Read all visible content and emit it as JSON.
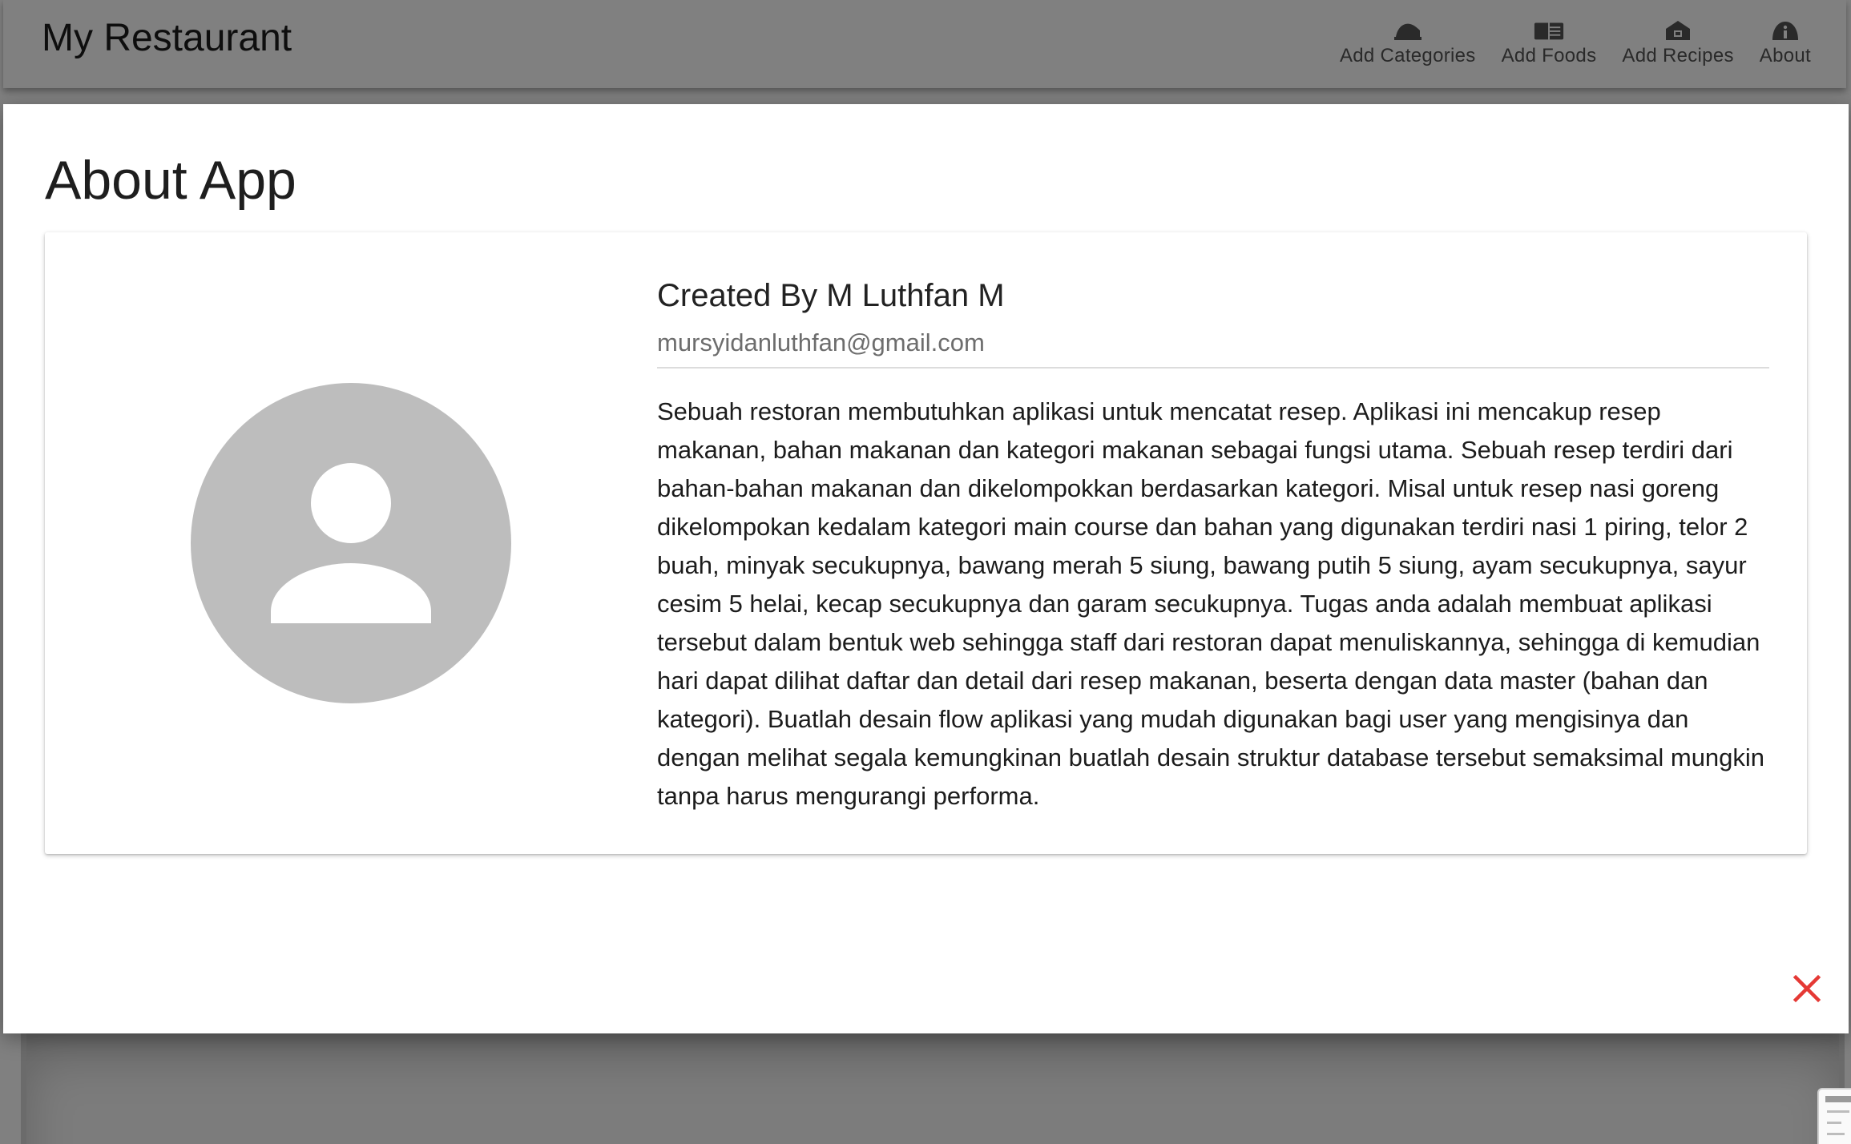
{
  "app": {
    "brand": "My Restaurant"
  },
  "nav": {
    "items": [
      {
        "label": "Add Categories",
        "icon": "categories-icon"
      },
      {
        "label": "Add Foods",
        "icon": "book-icon"
      },
      {
        "label": "Add Recipes",
        "icon": "store-icon"
      },
      {
        "label": "About",
        "icon": "info-icon"
      }
    ]
  },
  "modal": {
    "title": "About App",
    "creator": "Created By M Luthfan M",
    "email": "mursyidanluthfan@gmail.com",
    "description": "Sebuah restoran membutuhkan aplikasi untuk mencatat resep. Aplikasi ini mencakup resep makanan, bahan makanan dan kategori makanan sebagai fungsi utama. Sebuah resep terdiri dari bahan-bahan makanan dan dikelompokkan berdasarkan kategori. Misal untuk resep nasi goreng dikelompokan kedalam kategori main course dan bahan yang digunakan terdiri nasi 1 piring, telor 2 buah, minyak secukupnya, bawang merah 5 siung, bawang putih 5 siung, ayam secukupnya, sayur cesim 5 helai, kecap secukupnya dan garam secukupnya. Tugas anda adalah membuat aplikasi tersebut dalam bentuk web sehingga staff dari restoran dapat menuliskannya, sehingga di kemudian hari dapat dilihat daftar dan detail dari resep makanan, beserta dengan data master (bahan dan kategori). Buatlah desain flow aplikasi yang mudah digunakan bagi user yang mengisinya dan dengan melihat segala kemungkinan buatlah desain struktur database tersebut semaksimal mungkin tanpa harus mengurangi performa.",
    "close_icon": "close-icon"
  },
  "colors": {
    "overlay": "#808080",
    "close": "#e53935",
    "avatar_bg": "#bdbdbd"
  }
}
